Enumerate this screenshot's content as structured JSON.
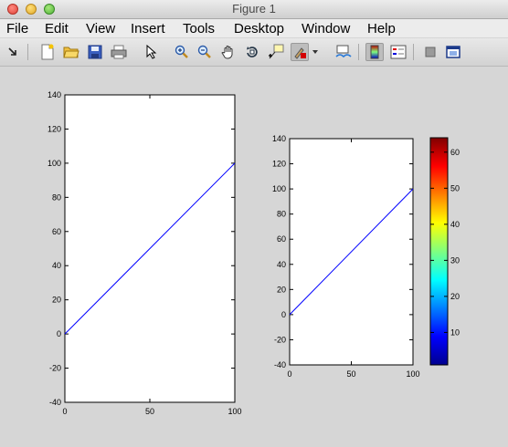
{
  "window": {
    "title": "Figure 1"
  },
  "menu": {
    "items": [
      "File",
      "Edit",
      "View",
      "Insert",
      "Tools",
      "Desktop",
      "Window",
      "Help"
    ]
  },
  "toolbar": {
    "buttons": [
      "arrow-dock-icon",
      "new-figure-icon",
      "open-file-icon",
      "save-icon",
      "print-icon",
      "pointer-icon",
      "zoom-in-icon",
      "zoom-out-icon",
      "pan-icon",
      "rotate-3d-icon",
      "data-cursor-icon",
      "brush-icon",
      "brush-dropdown-icon",
      "link-plot-icon",
      "insert-colorbar-icon",
      "insert-legend-icon",
      "hide-plot-tools-icon",
      "show-plot-tools-icon"
    ]
  },
  "chart_data": [
    {
      "type": "line",
      "title": "",
      "xlabel": "",
      "ylabel": "",
      "xlim": [
        0,
        100
      ],
      "ylim": [
        -40,
        140
      ],
      "xticks": [
        0,
        50,
        100
      ],
      "yticks": [
        -40,
        -20,
        0,
        20,
        40,
        60,
        80,
        100,
        120,
        140
      ],
      "series": [
        {
          "x": [
            0,
            100
          ],
          "y": [
            0,
            100
          ],
          "color": "#0000ff"
        }
      ]
    },
    {
      "type": "line",
      "title": "",
      "xlabel": "",
      "ylabel": "",
      "xlim": [
        0,
        100
      ],
      "ylim": [
        -40,
        140
      ],
      "xticks": [
        0,
        50,
        100
      ],
      "yticks": [
        -40,
        -20,
        0,
        20,
        40,
        60,
        80,
        100,
        120,
        140
      ],
      "series": [
        {
          "x": [
            0,
            100
          ],
          "y": [
            0,
            100
          ],
          "color": "#0000ff"
        }
      ]
    },
    {
      "type": "heatmap",
      "colormap": "jet",
      "clim": [
        1,
        64
      ],
      "ticks": [
        10,
        20,
        30,
        40,
        50,
        60
      ]
    }
  ]
}
